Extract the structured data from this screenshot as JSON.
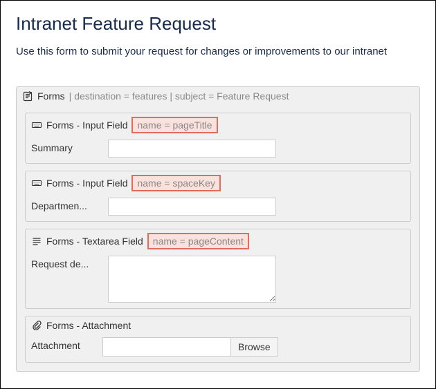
{
  "page": {
    "title": "Intranet Feature Request",
    "subtitle": "Use this form to submit your request for changes or improvements to our intranet"
  },
  "form_macro": {
    "label": "Forms",
    "params_text": "| destination = features | subject = Feature Request"
  },
  "fields": {
    "summary": {
      "macro_label": "Forms - Input Field",
      "param_text": "name = pageTitle",
      "label": "Summary",
      "value": ""
    },
    "department": {
      "macro_label": "Forms - Input Field",
      "param_text": "name = spaceKey",
      "label": "Departmen...",
      "value": ""
    },
    "request": {
      "macro_label": "Forms - Textarea Field",
      "param_text": "name = pageContent",
      "label": "Request de...",
      "value": ""
    },
    "attachment": {
      "macro_label": "Forms - Attachment",
      "label": "Attachment",
      "value": "",
      "browse_label": "Browse"
    }
  }
}
